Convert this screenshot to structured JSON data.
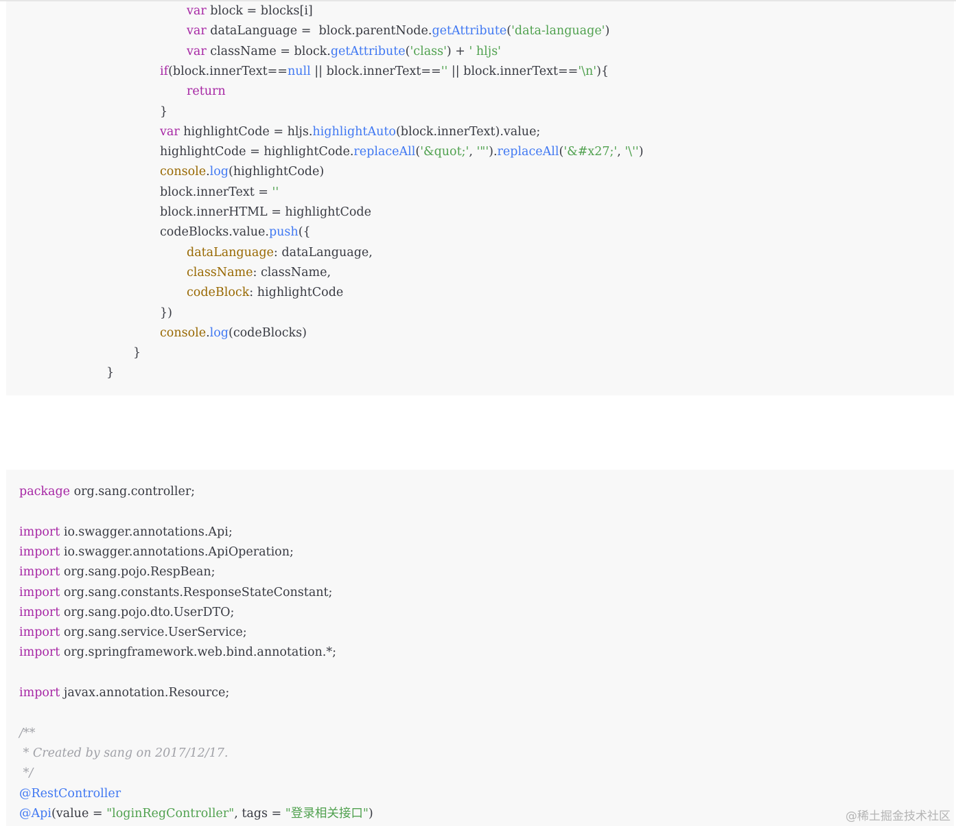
{
  "code_block_1": [
    {
      "indent": 4,
      "tokens": [
        [
          "kw",
          "var"
        ],
        [
          "plain",
          " block = blocks[i]"
        ]
      ]
    },
    {
      "indent": 4,
      "tokens": [
        [
          "kw",
          "var"
        ],
        [
          "plain",
          " dataLanguage =  block.parentNode."
        ],
        [
          "fn",
          "getAttribute"
        ],
        [
          "plain",
          "("
        ],
        [
          "str",
          "'data-language'"
        ],
        [
          "plain",
          ")"
        ]
      ]
    },
    {
      "indent": 4,
      "tokens": [
        [
          "kw",
          "var"
        ],
        [
          "plain",
          " className = block."
        ],
        [
          "fn",
          "getAttribute"
        ],
        [
          "plain",
          "("
        ],
        [
          "str",
          "'class'"
        ],
        [
          "plain",
          ") + "
        ],
        [
          "str",
          "' hljs'"
        ]
      ]
    },
    {
      "indent": 3,
      "tokens": [
        [
          "kw",
          "if"
        ],
        [
          "plain",
          "(block.innerText=="
        ],
        [
          "fn",
          "null"
        ],
        [
          "plain",
          " || block.innerText=="
        ],
        [
          "str",
          "''"
        ],
        [
          "plain",
          " || block.innerText=="
        ],
        [
          "str",
          "'\\n'"
        ],
        [
          "plain",
          "){"
        ]
      ]
    },
    {
      "indent": 4,
      "tokens": [
        [
          "kw",
          "return"
        ]
      ]
    },
    {
      "indent": 3,
      "tokens": [
        [
          "plain",
          "}"
        ]
      ]
    },
    {
      "indent": 3,
      "tokens": [
        [
          "kw",
          "var"
        ],
        [
          "plain",
          " highlightCode = hljs."
        ],
        [
          "fn",
          "highlightAuto"
        ],
        [
          "plain",
          "(block.innerText).value;"
        ]
      ]
    },
    {
      "indent": 3,
      "tokens": [
        [
          "plain",
          "highlightCode = highlightCode."
        ],
        [
          "fn",
          "replaceAll"
        ],
        [
          "plain",
          "("
        ],
        [
          "str",
          "'&quot;'"
        ],
        [
          "plain",
          ", "
        ],
        [
          "str",
          "'\"'"
        ],
        [
          "plain",
          ")."
        ],
        [
          "fn",
          "replaceAll"
        ],
        [
          "plain",
          "("
        ],
        [
          "str",
          "'&#x27;'"
        ],
        [
          "plain",
          ", "
        ],
        [
          "str",
          "'\\''"
        ],
        [
          "plain",
          ")"
        ]
      ]
    },
    {
      "indent": 3,
      "tokens": [
        [
          "attr",
          "console"
        ],
        [
          "plain",
          "."
        ],
        [
          "fn",
          "log"
        ],
        [
          "plain",
          "(highlightCode)"
        ]
      ]
    },
    {
      "indent": 3,
      "tokens": [
        [
          "plain",
          "block.innerText = "
        ],
        [
          "str",
          "''"
        ]
      ]
    },
    {
      "indent": 3,
      "tokens": [
        [
          "plain",
          "block.innerHTML = highlightCode"
        ]
      ]
    },
    {
      "indent": 3,
      "tokens": [
        [
          "plain",
          "codeBlocks.value."
        ],
        [
          "fn",
          "push"
        ],
        [
          "plain",
          "({"
        ]
      ]
    },
    {
      "indent": 4,
      "tokens": [
        [
          "attr",
          "dataLanguage"
        ],
        [
          "plain",
          ": dataLanguage,"
        ]
      ]
    },
    {
      "indent": 4,
      "tokens": [
        [
          "attr",
          "className"
        ],
        [
          "plain",
          ": className,"
        ]
      ]
    },
    {
      "indent": 4,
      "tokens": [
        [
          "attr",
          "codeBlock"
        ],
        [
          "plain",
          ": highlightCode"
        ]
      ]
    },
    {
      "indent": 3,
      "tokens": [
        [
          "plain",
          "})"
        ]
      ]
    },
    {
      "indent": 3,
      "tokens": [
        [
          "attr",
          "console"
        ],
        [
          "plain",
          "."
        ],
        [
          "fn",
          "log"
        ],
        [
          "plain",
          "(codeBlocks)"
        ]
      ]
    },
    {
      "indent": 2,
      "tokens": [
        [
          "plain",
          "}"
        ]
      ]
    },
    {
      "indent": 1,
      "tokens": [
        [
          "plain",
          "}"
        ]
      ]
    }
  ],
  "code_block_2": [
    {
      "indent": 0,
      "tokens": [
        [
          "kw",
          "package"
        ],
        [
          "plain",
          " org.sang.controller;"
        ]
      ]
    },
    {
      "indent": 0,
      "tokens": []
    },
    {
      "indent": 0,
      "tokens": [
        [
          "kw",
          "import"
        ],
        [
          "plain",
          " io.swagger.annotations.Api;"
        ]
      ]
    },
    {
      "indent": 0,
      "tokens": [
        [
          "kw",
          "import"
        ],
        [
          "plain",
          " io.swagger.annotations.ApiOperation;"
        ]
      ]
    },
    {
      "indent": 0,
      "tokens": [
        [
          "kw",
          "import"
        ],
        [
          "plain",
          " org.sang.pojo.RespBean;"
        ]
      ]
    },
    {
      "indent": 0,
      "tokens": [
        [
          "kw",
          "import"
        ],
        [
          "plain",
          " org.sang.constants.ResponseStateConstant;"
        ]
      ]
    },
    {
      "indent": 0,
      "tokens": [
        [
          "kw",
          "import"
        ],
        [
          "plain",
          " org.sang.pojo.dto.UserDTO;"
        ]
      ]
    },
    {
      "indent": 0,
      "tokens": [
        [
          "kw",
          "import"
        ],
        [
          "plain",
          " org.sang.service.UserService;"
        ]
      ]
    },
    {
      "indent": 0,
      "tokens": [
        [
          "kw",
          "import"
        ],
        [
          "plain",
          " org.springframework.web.bind.annotation.*;"
        ]
      ]
    },
    {
      "indent": 0,
      "tokens": []
    },
    {
      "indent": 0,
      "tokens": [
        [
          "kw",
          "import"
        ],
        [
          "plain",
          " javax.annotation.Resource;"
        ]
      ]
    },
    {
      "indent": 0,
      "tokens": []
    },
    {
      "indent": 0,
      "tokens": [
        [
          "com",
          "/**"
        ]
      ]
    },
    {
      "indent": 0,
      "tokens": [
        [
          "com",
          " * Created by sang on 2017/12/17."
        ]
      ]
    },
    {
      "indent": 0,
      "tokens": [
        [
          "com",
          " */"
        ]
      ]
    },
    {
      "indent": 0,
      "tokens": [
        [
          "fn",
          "@RestController"
        ]
      ]
    },
    {
      "indent": 0,
      "tokens": [
        [
          "fn",
          "@Api"
        ],
        [
          "plain",
          "(value = "
        ],
        [
          "str",
          "\"loginRegController\""
        ],
        [
          "plain",
          ", tags = "
        ],
        [
          "str",
          "\"登录相关接口\""
        ],
        [
          "plain",
          ")"
        ]
      ]
    }
  ],
  "watermark": "@稀土掘金技术社区"
}
